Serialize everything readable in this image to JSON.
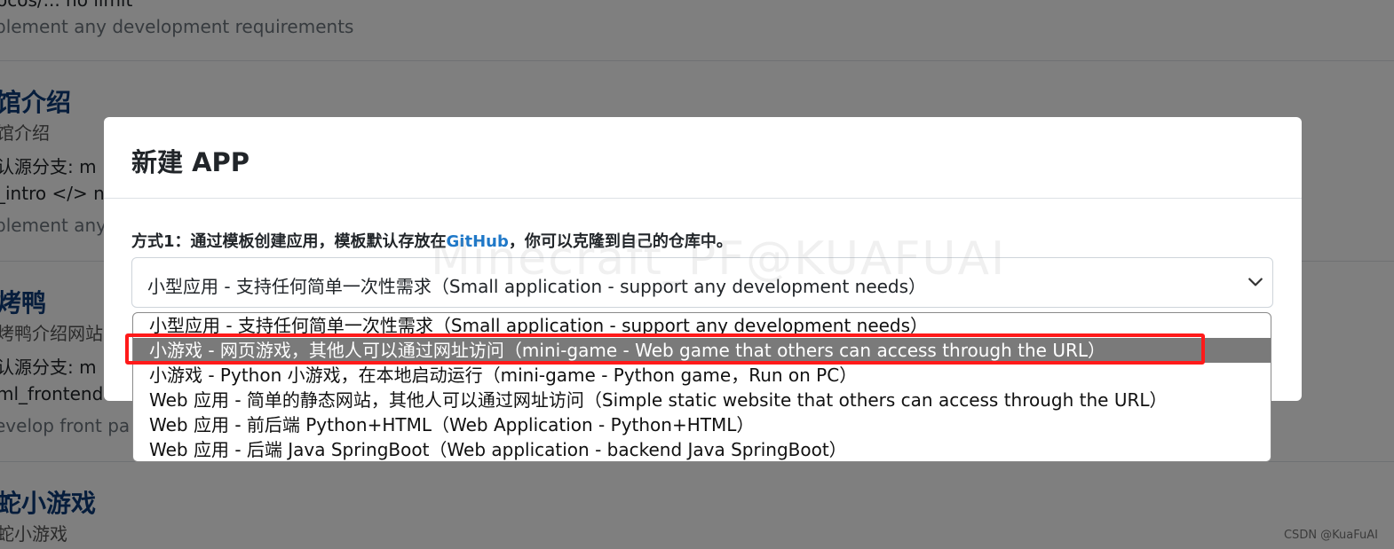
{
  "background": {
    "items": [
      {
        "title": "",
        "subtitle": "",
        "meta": "ocos/... no limit",
        "desc": "plement any development requirements"
      },
      {
        "title": "馆介绍",
        "subtitle": "馆介绍",
        "meta": "认源分支: m",
        "code": "_intro </> no",
        "desc": "plement any"
      },
      {
        "title": "烤鸭",
        "subtitle": "烤鸭介绍网站",
        "meta": "认源分支: m",
        "code": "ml_frontend",
        "desc": "evelop front pa"
      },
      {
        "title": "蛇小游戏",
        "subtitle": "蛇小游戏"
      }
    ]
  },
  "modal": {
    "title": "新建 APP",
    "method_label": "方式1：通过模板创建应用，模板默认存放在",
    "method_link": "GitHub",
    "method_suffix": "，你可以克隆到自己的仓库中。",
    "select_value": "小型应用 - 支持任何简单一次性需求（Small application - support any development needs）"
  },
  "watermark": "Minecraft_PF@KUAFUAI",
  "dropdown": {
    "options": [
      "小型应用 - 支持任何简单一次性需求（Small application - support any development needs）",
      "小游戏 - 网页游戏，其他人可以通过网址访问（mini-game - Web game that others can access through the URL）",
      "小游戏 - Python 小游戏，在本地启动运行（mini-game - Python game，Run on PC）",
      "Web 应用 - 简单的静态网站，其他人可以通过网址访问（Simple static website that others can access through the URL）",
      "Web 应用 - 前后端 Python+HTML（Web Application - Python+HTML）",
      "Web 应用 - 后端 Java SpringBoot（Web application - backend Java SpringBoot）"
    ],
    "selected_index": 1
  },
  "credit": "CSDN @KuaFuAI",
  "colors": {
    "highlight": "#ff1a1a",
    "selected_bg": "#7a7a7a",
    "link": "#1f78c8"
  }
}
